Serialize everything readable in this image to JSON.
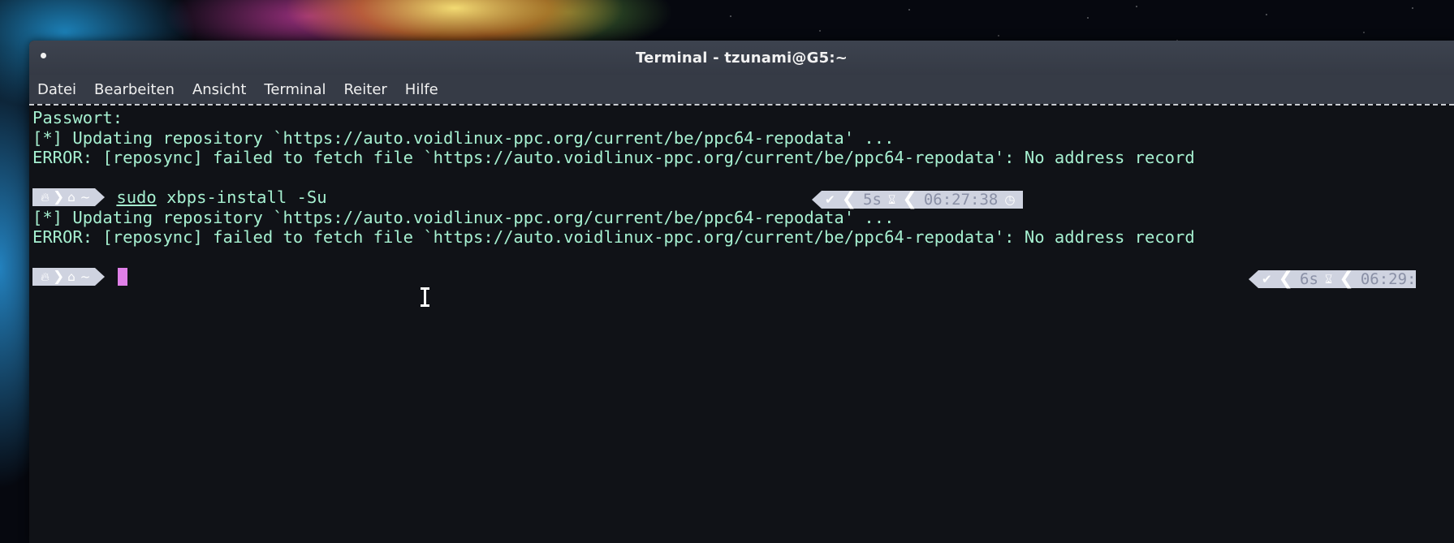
{
  "window": {
    "title": "Terminal - tzunami@G5:~"
  },
  "menubar": {
    "items": [
      "Datei",
      "Bearbeiten",
      "Ansicht",
      "Terminal",
      "Reiter",
      "Hilfe"
    ]
  },
  "terminal": {
    "lines": {
      "password": "Passwort:",
      "updating_1": "[*] Updating repository `https://auto.voidlinux-ppc.org/current/be/ppc64-repodata' ...",
      "error_1": "ERROR: [reposync] failed to fetch file `https://auto.voidlinux-ppc.org/current/be/ppc64-repodata': No address record",
      "updating_2": "[*] Updating repository `https://auto.voidlinux-ppc.org/current/be/ppc64-repodata' ...",
      "error_2": "ERROR: [reposync] failed to fetch file `https://auto.voidlinux-ppc.org/current/be/ppc64-repodata': No address record"
    },
    "prompt": {
      "os_icon": "fire-icon",
      "home_icon": "home-icon",
      "dir": "~"
    },
    "command": {
      "sudo": "sudo",
      "rest": " xbps-install -Su"
    },
    "right_prompt_1": {
      "status_icon": "checkmark-icon",
      "duration": "5s",
      "duration_icon": "hourglass-icon",
      "time": "06:27:38",
      "time_icon": "clock-icon"
    },
    "right_prompt_2": {
      "status_icon": "checkmark-icon",
      "duration": "6s",
      "duration_icon": "hourglass-icon",
      "time": "06:29:"
    }
  },
  "colors": {
    "terminal_text": "#a6f0d0",
    "terminal_bg": "#101217",
    "prompt_segment": "#cfd3e0",
    "cursor": "#e080e8"
  }
}
